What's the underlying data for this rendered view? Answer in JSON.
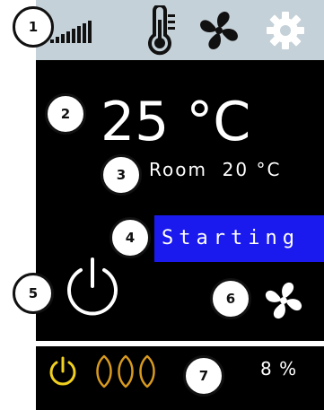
{
  "colors": {
    "topbar_bg": "#c5d1d8",
    "screen_bg": "#000000",
    "status_bg": "#1a1aee",
    "power_eco": "#f0d020",
    "heat_wave": "#d89a20"
  },
  "icons": {
    "signal": "signal-strength-icon",
    "thermometer": "thermometer-icon",
    "fan_tab": "fan-icon",
    "settings": "gear-icon",
    "power": "power-icon",
    "fan_button": "fan-icon",
    "status_power": "power-icon",
    "heat": "heat-wave-icon"
  },
  "callouts": [
    "1",
    "2",
    "3",
    "4",
    "5",
    "6",
    "7"
  ],
  "main": {
    "setpoint": "25 °C",
    "room_label": "Room  20 °C",
    "status": "Starting"
  },
  "footer": {
    "level": "8 %"
  }
}
